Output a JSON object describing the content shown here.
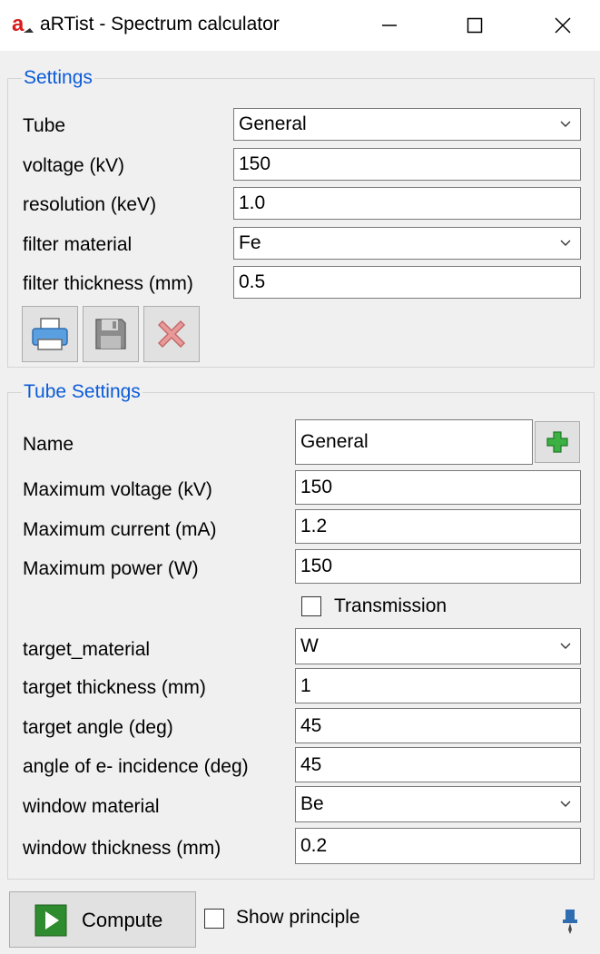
{
  "window": {
    "title": "aRTist - Spectrum calculator",
    "icon": "artist-app-icon",
    "controls": [
      "minimize-icon",
      "maximize-icon",
      "close-icon"
    ]
  },
  "settings": {
    "group_title": "Settings",
    "tube_label": "Tube",
    "tube_value": "General",
    "voltage_label": "voltage (kV)",
    "voltage_value": "150",
    "resolution_label": "resolution (keV)",
    "resolution_value": "1.0",
    "filter_material_label": "filter material",
    "filter_material_value": "Fe",
    "filter_thickness_label": "filter thickness (mm)",
    "filter_thickness_value": "0.5",
    "toolbar_icons": [
      "print-icon",
      "save-icon",
      "delete-icon"
    ]
  },
  "tube_settings": {
    "group_title": "Tube Settings",
    "name_label": "Name",
    "name_value": "General",
    "add_icon": "plus-icon",
    "max_voltage_label": "Maximum voltage (kV)",
    "max_voltage_value": "150",
    "max_current_label": "Maximum current (mA)",
    "max_current_value": "1.2",
    "max_power_label": "Maximum power (W)",
    "max_power_value": "150",
    "transmission_label": "Transmission",
    "transmission_checked": false,
    "target_material_label": "target_material",
    "target_material_value": "W",
    "target_thickness_label": "target thickness (mm)",
    "target_thickness_value": "1",
    "target_angle_label": "target angle (deg)",
    "target_angle_value": "45",
    "incidence_angle_label": "angle of e- incidence (deg)",
    "incidence_angle_value": "45",
    "window_material_label": "window material",
    "window_material_value": "Be",
    "window_thickness_label": "window thickness (mm)",
    "window_thickness_value": "0.2"
  },
  "footer": {
    "compute_label": "Compute",
    "compute_icon": "play-icon",
    "show_principle_label": "Show principle",
    "show_principle_checked": false,
    "pin_icon": "pin-icon"
  },
  "colors": {
    "group_title": "#0b5bd8",
    "window_bg": "#f0f0f0",
    "field_border": "#7a7a7a"
  }
}
